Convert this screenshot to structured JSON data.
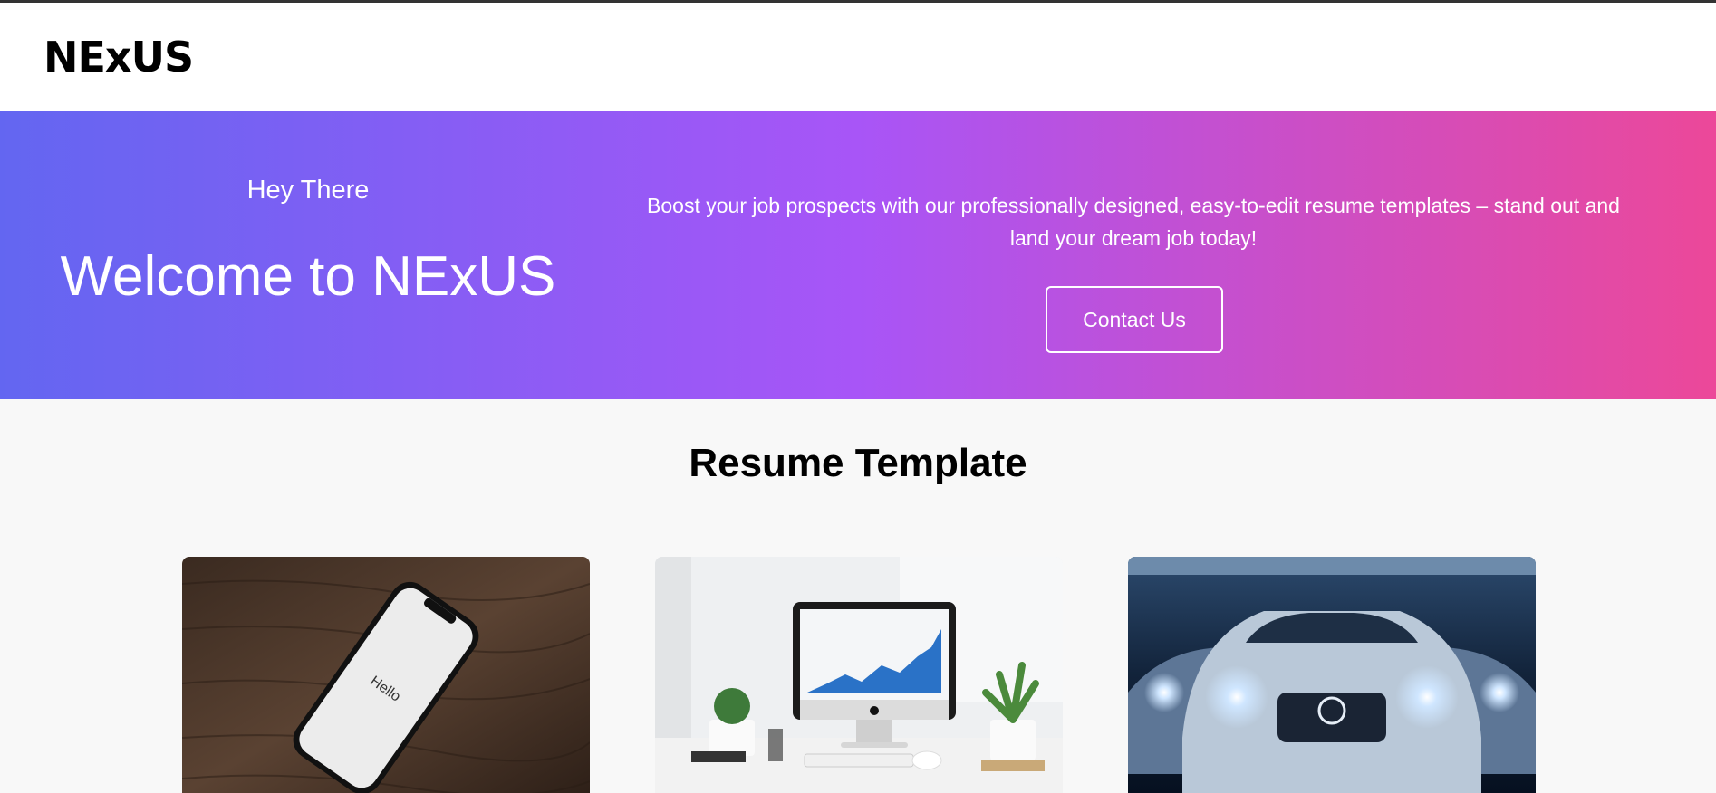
{
  "header": {
    "logo": "NExUS"
  },
  "hero": {
    "greeting": "Hey There",
    "welcome": "Welcome to NExUS",
    "blurb": "Boost your job prospects with our professionally designed, easy-to-edit resume templates – stand out and land your dream job today!",
    "contact_label": "Contact Us"
  },
  "templates": {
    "title": "Resume Template",
    "cards": [
      {
        "image": "phone-on-wood-photo",
        "phone_text": "Hello"
      },
      {
        "image": "desk-with-monitor-photo"
      },
      {
        "image": "silver-car-headlights-photo"
      }
    ]
  },
  "colors": {
    "gradient_start": "#6366f1",
    "gradient_mid": "#a855f7",
    "gradient_end": "#ec4899"
  }
}
